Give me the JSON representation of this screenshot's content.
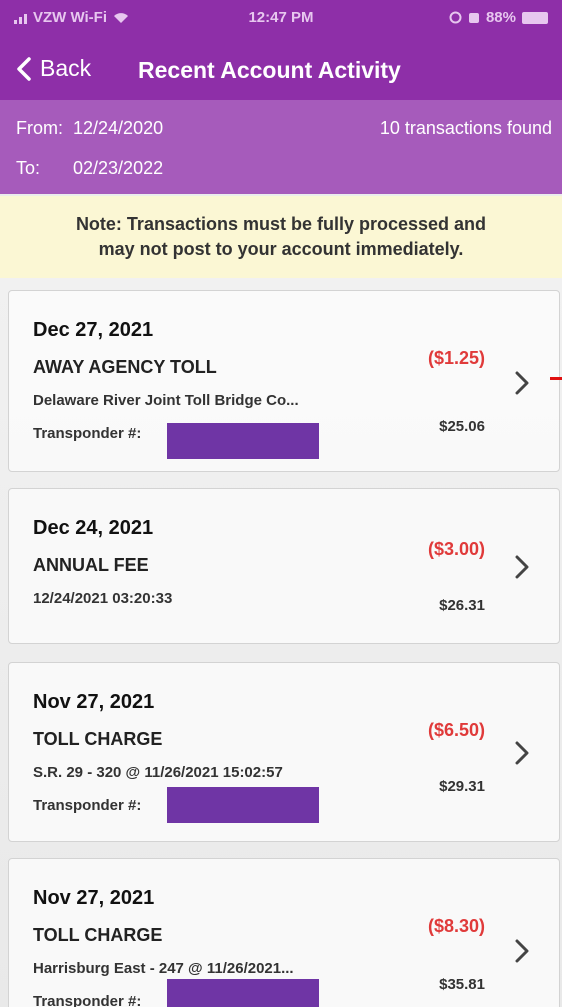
{
  "status_bar": {
    "carrier": "VZW Wi-Fi",
    "time": "12:47 PM",
    "battery": "88%"
  },
  "nav": {
    "back_label": "Back",
    "title": "Recent Account Activity"
  },
  "range": {
    "from_label": "From:",
    "from_date": "12/24/2020",
    "to_label": "To:",
    "to_date": "02/23/2022",
    "count_text": "10 transactions found"
  },
  "note": {
    "line1": "Note: Transactions must be fully processed and",
    "line2": "may not post to your account immediately."
  },
  "transactions": [
    {
      "date": "Dec 27, 2021",
      "type": "AWAY AGENCY TOLL",
      "detail": "Delaware River Joint Toll Bridge Co...",
      "transponder_label": "Transponder #:",
      "amount": "($1.25)",
      "balance": "$25.06"
    },
    {
      "date": "Dec 24, 2021",
      "type": "ANNUAL FEE",
      "detail": "12/24/2021 03:20:33",
      "transponder_label": "",
      "amount": "($3.00)",
      "balance": "$26.31"
    },
    {
      "date": "Nov 27, 2021",
      "type": "TOLL CHARGE",
      "detail": "S.R. 29 - 320 @ 11/26/2021 15:02:57",
      "transponder_label": "Transponder #:",
      "amount": "($6.50)",
      "balance": "$29.31"
    },
    {
      "date": "Nov 27, 2021",
      "type": "TOLL CHARGE",
      "detail": "Harrisburg East - 247 @ 11/26/2021...",
      "transponder_label": "Transponder #:",
      "amount": "($8.30)",
      "balance": "$35.81"
    }
  ],
  "colors": {
    "header": "#8e2fa8",
    "subheader": "#a65bbb",
    "negative_amount": "#e03a3a",
    "redaction": "#6f35a5",
    "note_bg": "#fbf7d4"
  }
}
